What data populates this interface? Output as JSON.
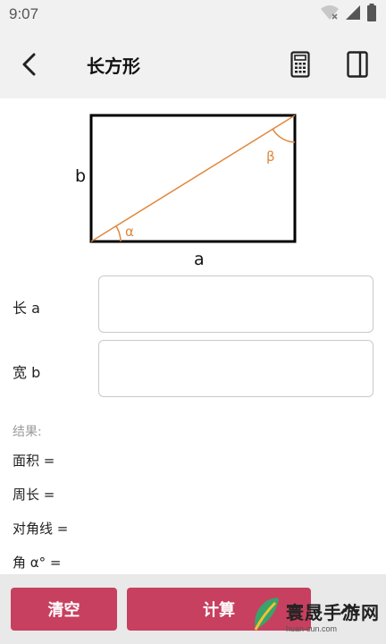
{
  "status": {
    "time": "9:07"
  },
  "header": {
    "title": "长方形"
  },
  "diagram": {
    "label_a": "a",
    "label_b": "b",
    "label_alpha": "α",
    "label_beta": "β",
    "colors": {
      "border": "#000000",
      "diagonal": "#e0873c"
    }
  },
  "form": {
    "length_label": "长 a",
    "length_value": "",
    "width_label": "宽 b",
    "width_value": ""
  },
  "results": {
    "title": "结果:",
    "area": "面积 =",
    "perimeter": "周长 =",
    "diagonal": "对角线 =",
    "angle": "角  α° ="
  },
  "actions": {
    "clear_label": "清空",
    "calculate_label": "计算"
  },
  "watermark": {
    "name": "寰晟手游网",
    "url": "huan-sun.com"
  },
  "theme": {
    "accent": "#c7405f",
    "bar_bg": "#f1f1f1"
  }
}
